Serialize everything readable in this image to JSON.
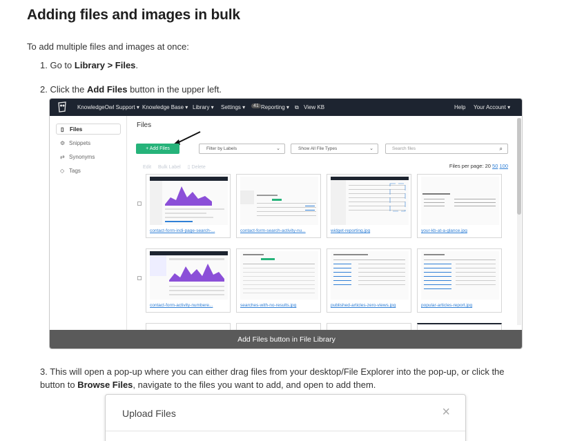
{
  "article": {
    "title": "Adding files and images in bulk",
    "intro": "To add multiple files and images at once:",
    "step1": {
      "num": "1.",
      "pre": "Go to ",
      "bold": "Library > Files",
      "post": "."
    },
    "step2": {
      "num": "2.",
      "pre": "Click the ",
      "bold": "Add Files",
      "post": " button in the upper left."
    },
    "step3": {
      "num": "3.",
      "pre": "This will open a pop-up where you can either drag files from your desktop/File Explorer into the pop-up, or click the button to ",
      "bold": "Browse Files",
      "post": ", navigate to the files you want to add, and open to add them."
    }
  },
  "screenshot": {
    "caption": "Add Files button in File Library",
    "nav": {
      "brand": "KnowledgeOwl Support ▾",
      "kb": "Knowledge Base ▾",
      "library": "Library ▾",
      "settings": "Settings ▾",
      "reporting_badge": "41",
      "reporting": "Reporting ▾",
      "view_kb": "View KB",
      "help": "Help",
      "account": "Your Account ▾"
    },
    "sidebar": [
      {
        "icon": "file-icon",
        "glyph": "▯",
        "label": "Files"
      },
      {
        "icon": "snippets-icon",
        "glyph": "⚙",
        "label": "Snippets"
      },
      {
        "icon": "synonyms-icon",
        "glyph": "⇄",
        "label": "Synonyms"
      },
      {
        "icon": "tag-icon",
        "glyph": "◇",
        "label": "Tags"
      }
    ],
    "heading": "Files",
    "add_files": "+ Add Files",
    "filter_labels": "Filter by Labels",
    "file_types": "Show All File Types",
    "search_placeholder": "Search files",
    "actions": {
      "edit": "Edit",
      "bulk_label": "Bulk Label",
      "delete": "Delete"
    },
    "per_page": {
      "label": "Files per page:",
      "opt1": "20",
      "opt2": "50",
      "opt3": "100"
    },
    "files": [
      "contact-form-indi-page-search-...",
      "contact-form-search-activity-nu...",
      "widget-reporting.jpg",
      "your-kb-at-a-glance.jpg",
      "contact-form-activity-numbere...",
      "searches-with-no-results.jpg",
      "published-articles-zero-views.jpg",
      "popular-articles-report.jpg"
    ]
  },
  "dialog": {
    "title": "Upload Files",
    "close": "×"
  },
  "colors": {
    "accent_green": "#26b37a",
    "nav_bg": "#1d2430",
    "link_blue": "#2f7fd6",
    "chart_purple": "#8b4fd8"
  }
}
